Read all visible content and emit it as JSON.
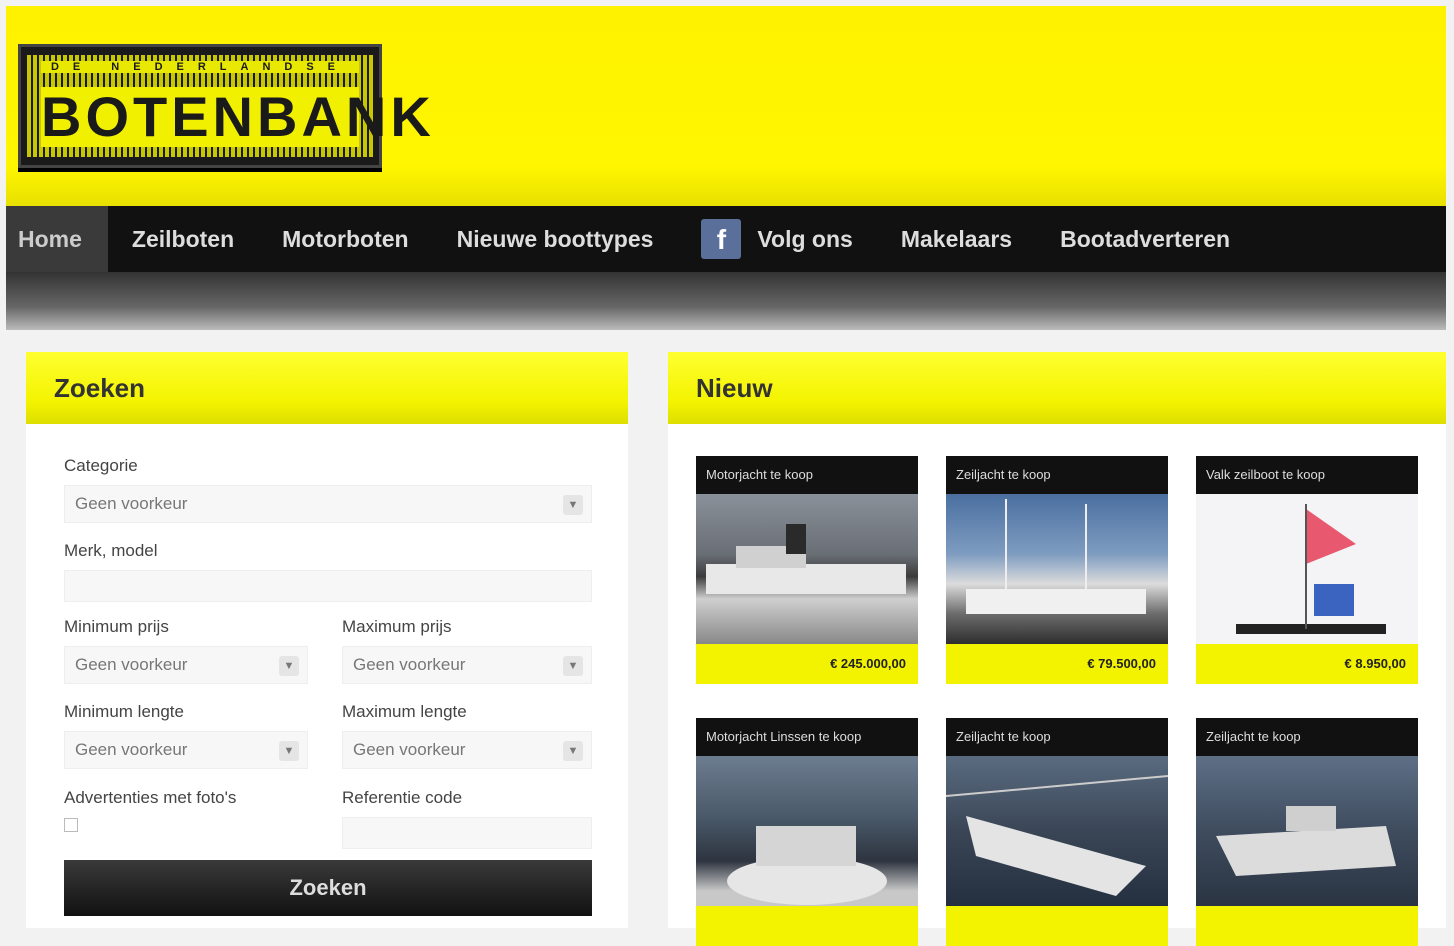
{
  "header": {
    "logo_top": "DE NEDERLANDSE",
    "logo_text": "BOTENBANK"
  },
  "nav": {
    "items": [
      "Home",
      "Zeilboten",
      "Motorboten",
      "Nieuwe boottypes",
      "Volg ons",
      "Makelaars",
      "Bootadverteren"
    ],
    "facebook_glyph": "f"
  },
  "search": {
    "title": "Zoeken",
    "category_label": "Categorie",
    "category_value": "Geen voorkeur",
    "keyword_label": "Merk, model",
    "min_price_label": "Minimum prijs",
    "min_price_value": "Geen voorkeur",
    "max_price_label": "Maximum prijs",
    "max_price_value": "Geen voorkeur",
    "min_length_label": "Minimum lengte",
    "min_length_value": "Geen voorkeur",
    "max_length_label": "Maximum lengte",
    "max_length_value": "Geen voorkeur",
    "only_photos_label": "Advertenties met foto's",
    "reference_label": "Referentie code",
    "button": "Zoeken"
  },
  "news": {
    "title": "Nieuw",
    "cards": [
      {
        "title": "Motorjacht te koop",
        "price": "€ 245.000,00"
      },
      {
        "title": "Zeiljacht te koop",
        "price": "€ 79.500,00"
      },
      {
        "title": "Valk zeilboot te koop",
        "price": "€ 8.950,00"
      },
      {
        "title": "Motorjacht Linssen te koop",
        "price": ""
      },
      {
        "title": "Zeiljacht te koop",
        "price": ""
      },
      {
        "title": "Zeiljacht te koop",
        "price": ""
      }
    ]
  },
  "colors": {
    "brand_yellow": "#fff200",
    "nav_black": "#111111"
  }
}
